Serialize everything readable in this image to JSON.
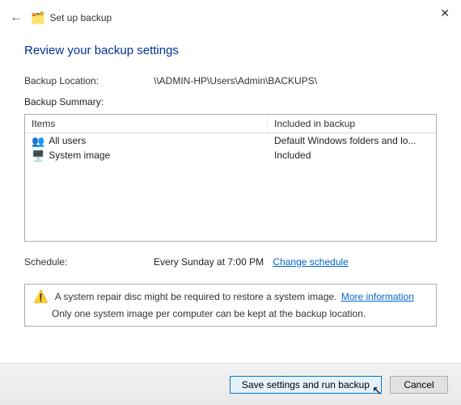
{
  "header": {
    "title": "Set up backup",
    "close": "✕"
  },
  "heading": "Review your backup settings",
  "location_label": "Backup Location:",
  "location_value": "\\\\ADMIN-HP\\Users\\Admin\\BACKUPS\\",
  "summary_label": "Backup Summary:",
  "table": {
    "col_items": "Items",
    "col_included": "Included in backup",
    "rows": [
      {
        "icon": "👥",
        "item": "All users",
        "included": "Default Windows folders and lo..."
      },
      {
        "icon": "🖥️",
        "item": "System image",
        "included": "Included"
      }
    ]
  },
  "schedule_label": "Schedule:",
  "schedule_value": "Every Sunday at 7:00 PM",
  "schedule_link": "Change schedule",
  "warning": {
    "line1a": "A system repair disc might be required to restore a system image.",
    "more_info": "More information",
    "line2": "Only one system image per computer can be kept at the backup location."
  },
  "buttons": {
    "save": "Save settings and run backup",
    "cancel": "Cancel"
  }
}
